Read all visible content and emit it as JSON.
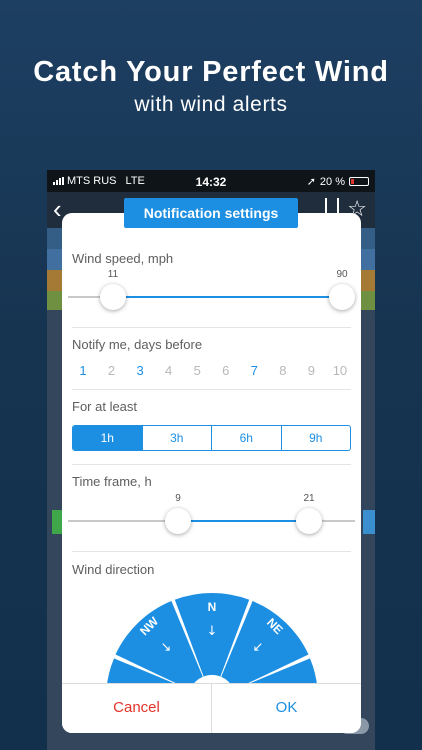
{
  "promo": {
    "headline": "Catch Your Perfect Wind",
    "subheadline": "with wind alerts"
  },
  "status_bar": {
    "carrier": "MTS RUS",
    "network": "LTE",
    "time": "14:32",
    "battery": "20 %"
  },
  "modal": {
    "title": "Notification settings",
    "wind_speed": {
      "label": "Wind speed, mph",
      "min_value": "11",
      "max_value": "90"
    },
    "notify_days": {
      "label": "Notify me, days before",
      "days": [
        {
          "label": "1",
          "selected": true
        },
        {
          "label": "2",
          "selected": false
        },
        {
          "label": "3",
          "selected": true
        },
        {
          "label": "4",
          "selected": false
        },
        {
          "label": "5",
          "selected": false
        },
        {
          "label": "6",
          "selected": false
        },
        {
          "label": "7",
          "selected": true
        },
        {
          "label": "8",
          "selected": false
        },
        {
          "label": "9",
          "selected": false
        },
        {
          "label": "10",
          "selected": false
        }
      ]
    },
    "for_at_least": {
      "label": "For at least",
      "options": [
        "1h",
        "3h",
        "6h",
        "9h"
      ],
      "selected": "1h"
    },
    "time_frame": {
      "label": "Time frame, h",
      "min_value": "9",
      "max_value": "21"
    },
    "wind_direction": {
      "label": "Wind direction",
      "sectors": [
        "NW",
        "N",
        "NE"
      ]
    },
    "cancel_label": "Cancel",
    "ok_label": "OK"
  },
  "colors": {
    "accent": "#1c8fe3",
    "cancel": "#e3342b",
    "background": "#1d3f62"
  }
}
